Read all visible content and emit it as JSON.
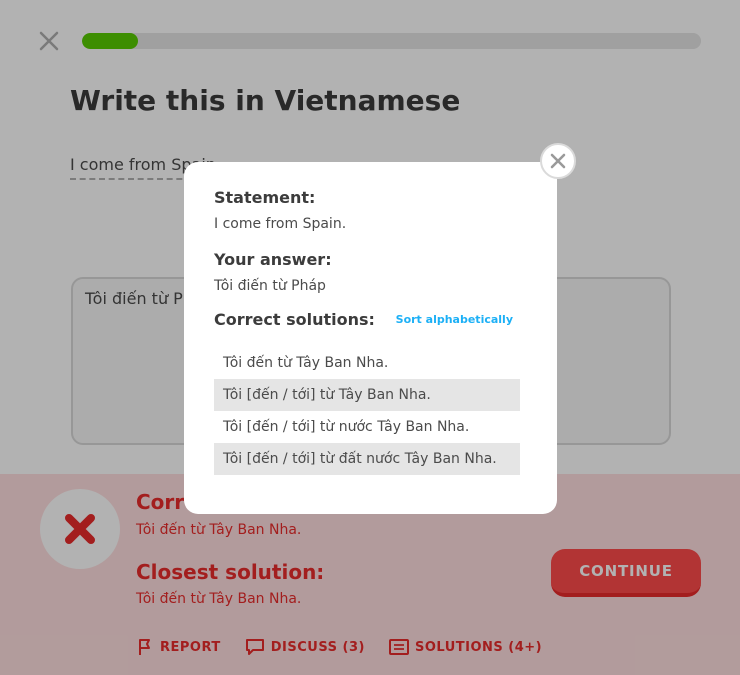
{
  "lesson": {
    "progress": 0.09,
    "title": "Write this in Vietnamese",
    "prompt": "I come from Spain.",
    "answer": "Tôi điến từ Pháp"
  },
  "footer": {
    "correct_heading": "Correct solution:",
    "correct_text": "Tôi đến từ Tây Ban Nha.",
    "closest_heading": "Closest solution:",
    "closest_text": "Tôi đến từ Tây Ban Nha.",
    "continue_label": "CONTINUE",
    "actions": {
      "report": "REPORT",
      "discuss": "DISCUSS (3)",
      "solutions": "SOLUTIONS (4+)"
    }
  },
  "modal": {
    "statement_label": "Statement:",
    "statement": "I come from Spain.",
    "your_answer_label": "Your answer:",
    "your_answer": "Tôi điến từ Pháp",
    "solutions_label": "Correct solutions:",
    "sort_label": "Sort alphabetically",
    "solutions": [
      "Tôi đến từ Tây Ban Nha.",
      "Tôi [đến / tới] từ Tây Ban Nha.",
      "Tôi [đến / tới] từ nước Tây Ban Nha.",
      "Tôi [đến / tới] từ đất nước Tây Ban Nha."
    ]
  },
  "icons": {
    "close": "close-icon",
    "fail": "x-mark-icon",
    "report": "flag-icon",
    "discuss": "speech-bubble-icon",
    "solutions": "list-icon"
  },
  "colors": {
    "progress": "#58cc02",
    "error": "#ea2b2b",
    "error_bg": "#ffdfe0",
    "button": "#ff4b4b",
    "link": "#1cb0f6"
  }
}
